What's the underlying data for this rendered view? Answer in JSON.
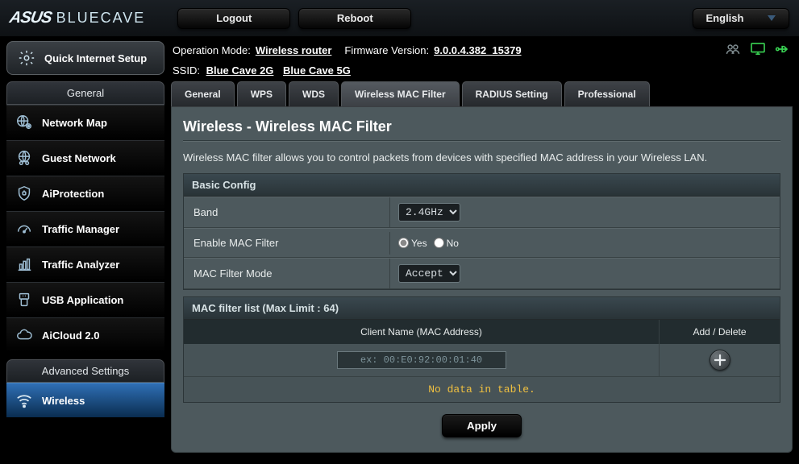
{
  "header": {
    "brand": "ASUS",
    "model": "BLUECAVE",
    "logout": "Logout",
    "reboot": "Reboot",
    "language": "English"
  },
  "status": {
    "op_mode_label": "Operation Mode:",
    "op_mode_value": "Wireless router",
    "fw_label": "Firmware Version:",
    "fw_value": "9.0.0.4.382_15379",
    "ssid_label": "SSID:",
    "ssid1": "Blue Cave 2G",
    "ssid2": "Blue Cave 5G"
  },
  "sidebar": {
    "quick_label": "Quick Internet Setup",
    "general_title": "General",
    "advanced_title": "Advanced Settings",
    "general_items": [
      {
        "label": "Network Map"
      },
      {
        "label": "Guest Network"
      },
      {
        "label": "AiProtection"
      },
      {
        "label": "Traffic Manager"
      },
      {
        "label": "Traffic Analyzer"
      },
      {
        "label": "USB Application"
      },
      {
        "label": "AiCloud 2.0"
      }
    ],
    "advanced_items": [
      {
        "label": "Wireless"
      }
    ]
  },
  "tabs": [
    {
      "label": "General"
    },
    {
      "label": "WPS"
    },
    {
      "label": "WDS"
    },
    {
      "label": "Wireless MAC Filter"
    },
    {
      "label": "RADIUS Setting"
    },
    {
      "label": "Professional"
    }
  ],
  "page": {
    "title": "Wireless - Wireless MAC Filter",
    "desc": "Wireless MAC filter allows you to control packets from devices with specified MAC address in your Wireless LAN.",
    "basic_title": "Basic Config",
    "band_label": "Band",
    "band_value": "2.4GHz",
    "enable_label": "Enable MAC Filter",
    "yes": "Yes",
    "no": "No",
    "mode_label": "MAC Filter Mode",
    "mode_value": "Accept",
    "maclist_title": "MAC filter list (Max Limit : 64)",
    "col_name": "Client Name (MAC Address)",
    "col_action": "Add / Delete",
    "mac_placeholder": "ex: 00:E0:92:00:01:40",
    "nodata": "No data in table.",
    "apply": "Apply"
  }
}
